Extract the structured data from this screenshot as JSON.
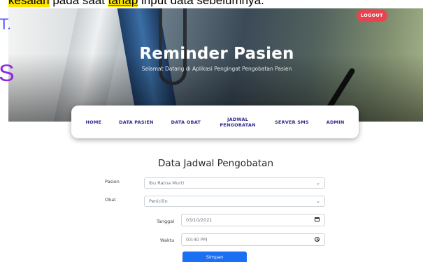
{
  "document_overlay": {
    "line_highlighted": "kesalan",
    "line_mid": " pada saat ",
    "line_underlined": "tahap",
    "line_tail": " input data sebelumnya."
  },
  "header": {
    "title": "Reminder Pasien",
    "subtitle": "Selamat Datang di Aplikasi Pengingat Pengobatan Pasien",
    "logout_label": "LOGOUT"
  },
  "nav": {
    "items": [
      {
        "label": "HOME"
      },
      {
        "label": "DATA PASIEN"
      },
      {
        "label": "DATA OBAT"
      },
      {
        "label": "JADWAL PENGOBATAN"
      },
      {
        "label": "SERVER SMS"
      },
      {
        "label": "ADMIN"
      }
    ]
  },
  "form": {
    "title": "Data Jadwal Pengobatan",
    "pasien": {
      "label": "Pasien",
      "value": "Ibu Ratna Murti"
    },
    "obat": {
      "label": "Obat",
      "value": "Penicilin"
    },
    "tanggal": {
      "label": "Tanggal",
      "value": "03/10/2021"
    },
    "waktu": {
      "label": "Waktu",
      "value": "03:40 PM"
    },
    "submit_label": "Simpan"
  },
  "colors": {
    "accent": "#1b6ff2",
    "nav_text": "#2c2b8c",
    "logout": "#e8444f"
  }
}
